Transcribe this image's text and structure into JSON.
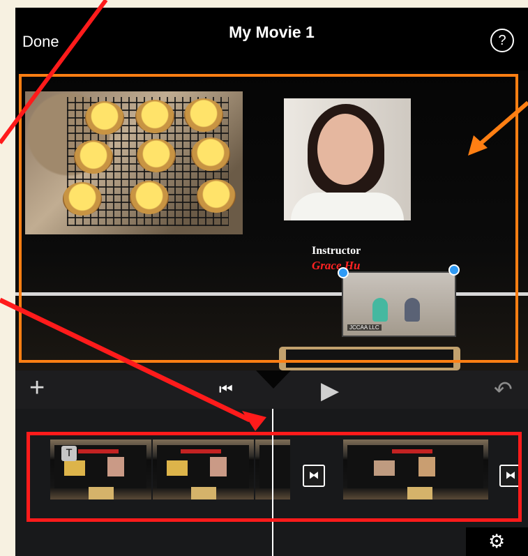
{
  "navbar": {
    "done_label": "Done",
    "title": "My Movie 1",
    "help_label": "?"
  },
  "preview": {
    "instructor_label": "Instructor",
    "instructor_name": "Grace Hu",
    "zoom_label": "JCCAA LLC"
  },
  "controls": {
    "add_label": "+",
    "skip_back_label": "⏮",
    "play_label": "▶",
    "undo_label": "↶"
  },
  "timeline": {
    "title_badge": "T",
    "transition_label": "⧓"
  },
  "colors": {
    "highlight_orange": "#ff7f13",
    "highlight_red": "#ff1b1b",
    "background": "#f7f1e1"
  },
  "icons": [
    "help-icon",
    "add-icon",
    "skip-back-icon",
    "play-icon",
    "undo-icon",
    "transition-icon",
    "settings-gear-icon"
  ]
}
